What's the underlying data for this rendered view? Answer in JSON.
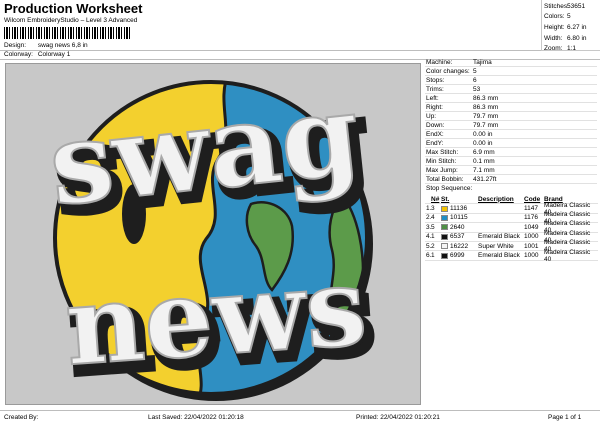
{
  "header": {
    "title": "Production Worksheet",
    "subtitle": "Wilcom EmbroideryStudio – Level 3 Advanced"
  },
  "meta": {
    "design_label": "Design:",
    "design_value": "swag news 6,8 in",
    "colorway_label": "Colorway:",
    "colorway_value": "Colorway 1"
  },
  "stats": [
    {
      "k": "Stitches:",
      "v": "53651"
    },
    {
      "k": "Colors:",
      "v": "5"
    },
    {
      "k": "Height:",
      "v": "6.27 in"
    },
    {
      "k": "Width:",
      "v": "6.80 in"
    },
    {
      "k": "Zoom:",
      "v": "1:1"
    }
  ],
  "design_text": {
    "top": "swag",
    "bottom": "news"
  },
  "colors": {
    "yellow": "#f3d02e",
    "blue": "#2f8fc2",
    "green": "#5c9b4a",
    "dark": "#1e1e1e",
    "white": "#f2f2f2",
    "background": "#c8c8c8"
  },
  "info": [
    {
      "k": "Machine:",
      "v": "Tajima"
    },
    {
      "k": "Color changes:",
      "v": "5"
    },
    {
      "k": "Stops:",
      "v": "6"
    },
    {
      "k": "Trims:",
      "v": "53"
    },
    {
      "k": "Left:",
      "v": "86.3 mm"
    },
    {
      "k": "Right:",
      "v": "86.3 mm"
    },
    {
      "k": "Up:",
      "v": "79.7 mm"
    },
    {
      "k": "Down:",
      "v": "79.7 mm"
    },
    {
      "k": "EndX:",
      "v": "0.00 in"
    },
    {
      "k": "EndY:",
      "v": "0.00 in"
    },
    {
      "k": "Max Stitch:",
      "v": "6.9 mm"
    },
    {
      "k": "Min Stitch:",
      "v": "0.1 mm"
    },
    {
      "k": "Max Jump:",
      "v": "7.1 mm"
    },
    {
      "k": "Total Bobbin:",
      "v": "431.27ft"
    }
  ],
  "sequence": {
    "title": "Stop Sequence:",
    "headers": [
      "",
      "N#",
      "St.",
      "Description",
      "Code",
      "Brand"
    ],
    "rows": [
      {
        "stop": "1.",
        "n": "3",
        "color": "#f3c200",
        "st": "11136",
        "desc": "",
        "code": "1147",
        "brand": "Madeira Classic 40"
      },
      {
        "stop": "2.",
        "n": "4",
        "color": "#1f8ec4",
        "st": "10115",
        "desc": "",
        "code": "1176",
        "brand": "Madeira Classic 40"
      },
      {
        "stop": "3.",
        "n": "5",
        "color": "#4f8f45",
        "st": "2640",
        "desc": "",
        "code": "1049",
        "brand": "Madeira Classic 40"
      },
      {
        "stop": "4.",
        "n": "1",
        "color": "#111111",
        "st": "6537",
        "desc": "Emerald Black",
        "code": "1000",
        "brand": "Madeira Classic 40"
      },
      {
        "stop": "5.",
        "n": "2",
        "color": "#f4f4f4",
        "st": "16222",
        "desc": "Super White",
        "code": "1001",
        "brand": "Madeira Classic 40"
      },
      {
        "stop": "6.",
        "n": "1",
        "color": "#111111",
        "st": "6999",
        "desc": "Emerald Black",
        "code": "1000",
        "brand": "Madeira Classic 40"
      }
    ]
  },
  "footer": {
    "created": "Created By:",
    "saved": "Last Saved: 22/04/2022 01:20:18",
    "printed": "Printed: 22/04/2022 01:20:21",
    "page": "Page 1 of 1"
  }
}
